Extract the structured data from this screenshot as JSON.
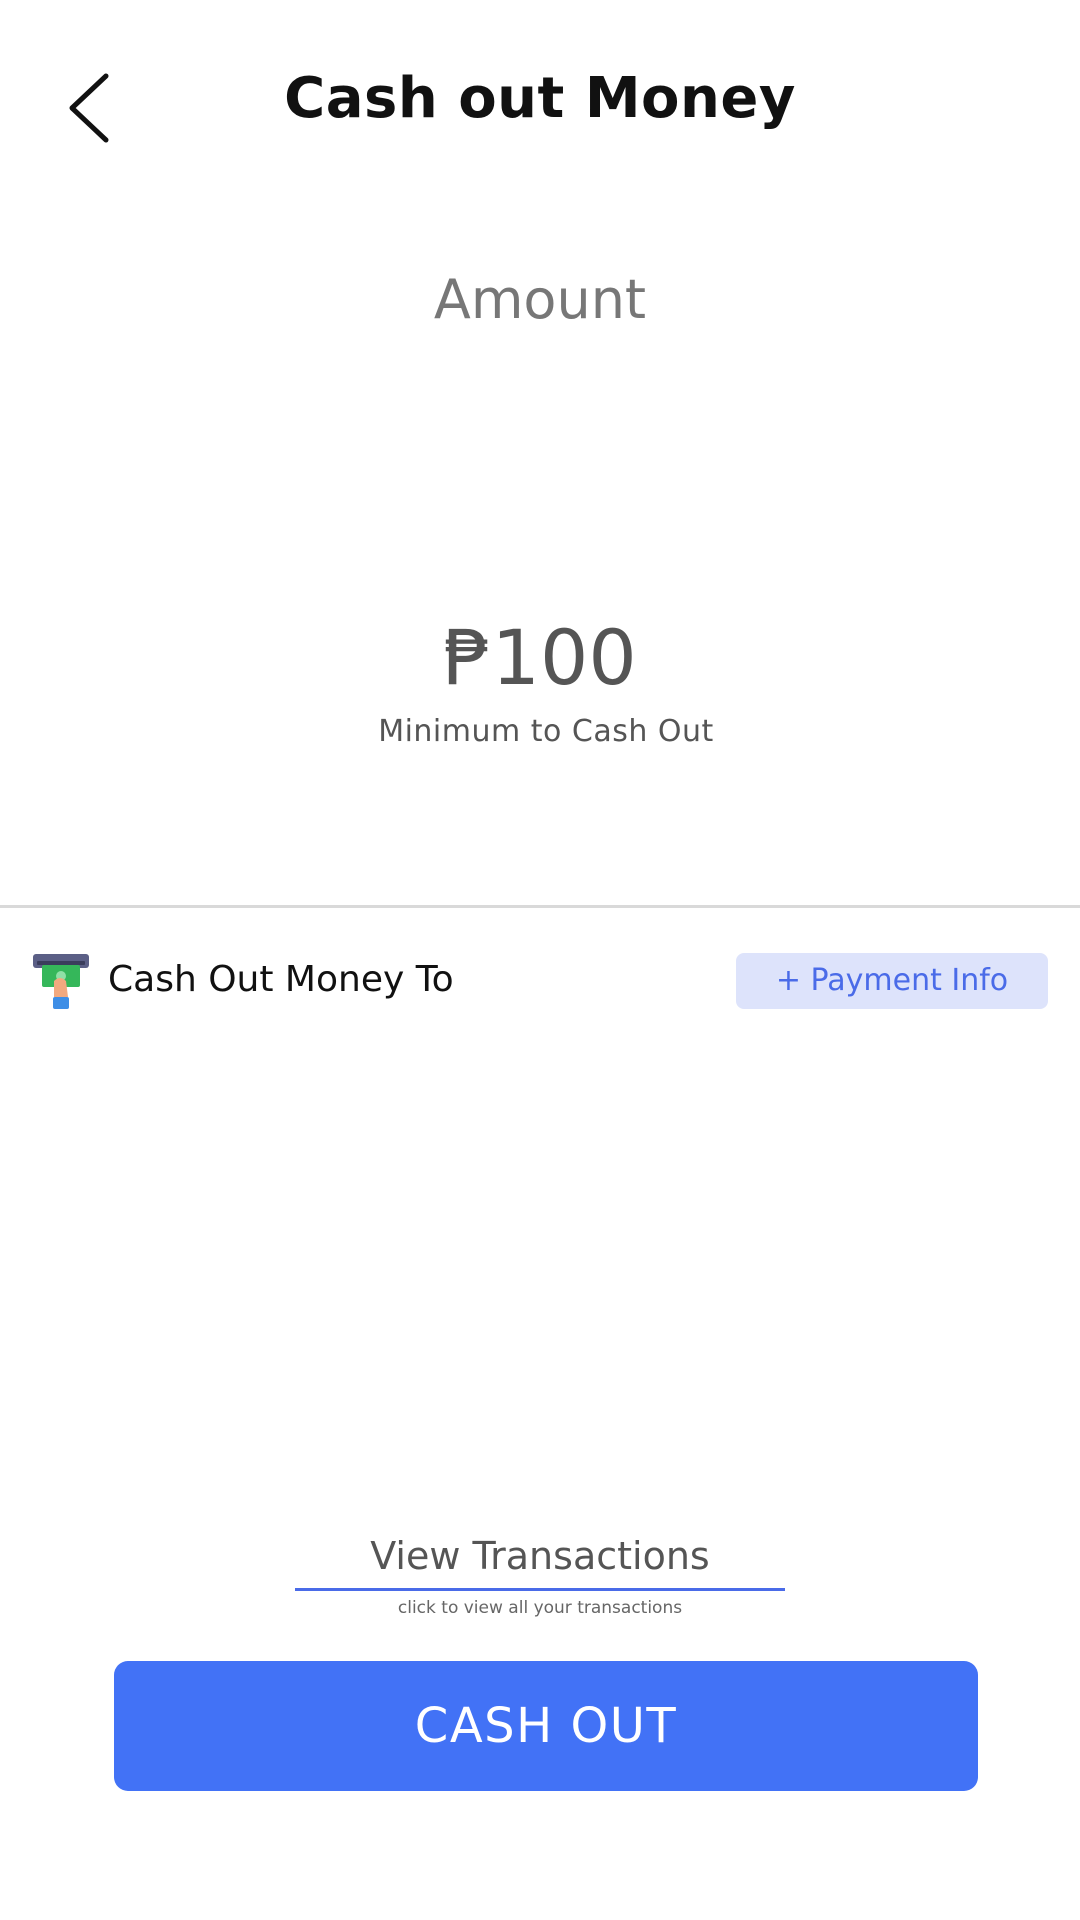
{
  "header": {
    "title": "Cash out Money",
    "back_icon": "chevron-left-icon"
  },
  "amount": {
    "label": "Amount",
    "minimum_value": "₱100",
    "minimum_caption": "Minimum to Cash Out"
  },
  "cashout_destination": {
    "icon": "atm-cash-icon",
    "label": "Cash Out Money To",
    "add_payment_label": "+ Payment Info"
  },
  "transactions": {
    "link_label": "View Transactions",
    "hint": "click to view all your transactions"
  },
  "actions": {
    "cash_out_label": "CASH OUT"
  },
  "colors": {
    "accent": "#4272f6",
    "link_underline": "#4a6be8",
    "payment_chip_bg": "#dde3fb",
    "payment_chip_text": "#4a6be8"
  }
}
